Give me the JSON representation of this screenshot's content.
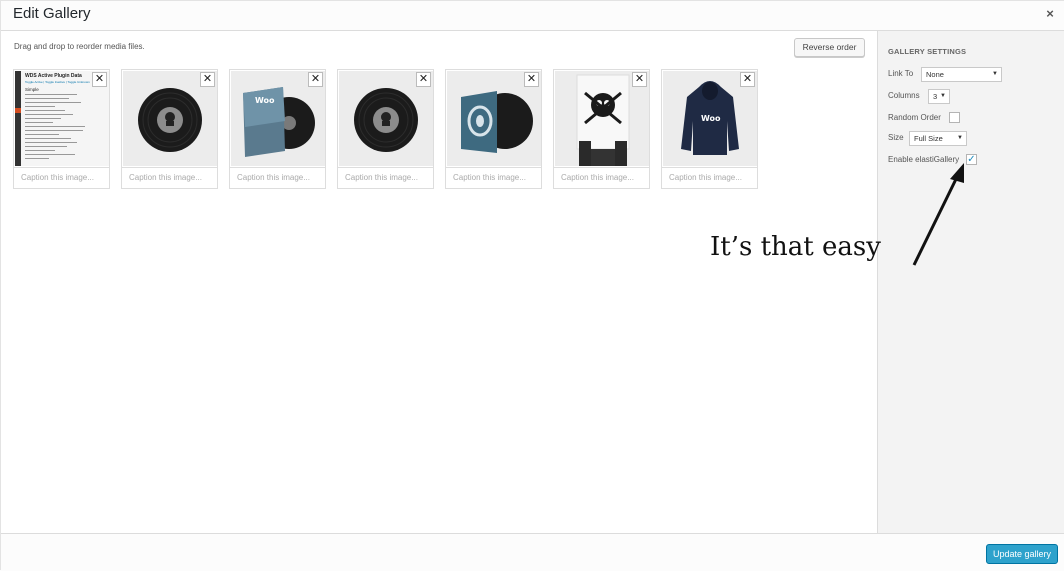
{
  "modal": {
    "title": "Edit Gallery",
    "close_glyph": "×"
  },
  "content": {
    "hint": "Drag and drop to reorder media files.",
    "reverse_label": "Reverse order"
  },
  "images": [
    {
      "kind": "plugin-doc",
      "caption_placeholder": "Caption this image...",
      "doc_title": "WDS Active Plugin Data",
      "doc_links": "Toggle Active | Toggle Inactive | Toggle Unknown",
      "doc_section": "Simple"
    },
    {
      "kind": "vinyl-record",
      "caption_placeholder": "Caption this image..."
    },
    {
      "kind": "album-sleeve",
      "caption_placeholder": "Caption this image...",
      "sleeve_text": "Woo"
    },
    {
      "kind": "vinyl-record",
      "caption_placeholder": "Caption this image..."
    },
    {
      "kind": "record-blue-sleeve",
      "caption_placeholder": "Caption this image..."
    },
    {
      "kind": "skull-poster",
      "caption_placeholder": "Caption this image..."
    },
    {
      "kind": "hoodie",
      "caption_placeholder": "Caption this image...",
      "hoodie_text": "Woo"
    }
  ],
  "sidebar": {
    "heading": "GALLERY SETTINGS",
    "link_to": {
      "label": "Link To",
      "value": "None"
    },
    "columns": {
      "label": "Columns",
      "value": "3"
    },
    "random_order": {
      "label": "Random Order",
      "checked": false
    },
    "size": {
      "label": "Size",
      "value": "Full Size"
    },
    "elasti": {
      "label": "Enable elastiGallery",
      "checked": true
    }
  },
  "footer": {
    "update_label": "Update gallery"
  },
  "annotation": {
    "text": "It’s that easy"
  },
  "colors": {
    "primary_button": "#2ea2cc",
    "checkbox_check": "#1e8cbe"
  }
}
